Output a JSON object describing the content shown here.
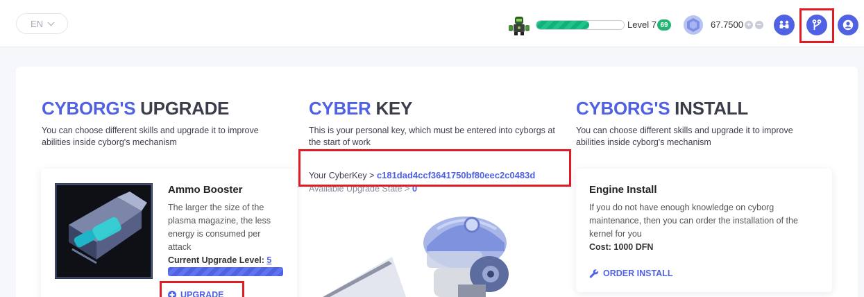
{
  "header": {
    "language": "EN",
    "level_label": "Level 7",
    "level_badge": "69",
    "xp_progress": 0.6,
    "balance": "67.7500"
  },
  "upgrade_section": {
    "title_accent": "CYBORG'S",
    "title_rest": " UPGRADE",
    "description": "You can choose different skills and upgrade it to improve abilities inside cyborg's mechanism",
    "card": {
      "title": "Ammo Booster",
      "text": "The larger the size of the plasma magazine, the less energy is consumed per attack",
      "level_label": "Current Upgrade Level: ",
      "level_value": "5",
      "level_progress": 1.0,
      "action": "UPGRADE"
    }
  },
  "key_section": {
    "title_accent": "CYBER",
    "title_rest": " KEY",
    "description": "This is your personal key, which must be entered into cyborgs at the start of work",
    "key_label": "Your CyberKey",
    "key_value": "c181dad4ccf3641750bf80eec2c0483d",
    "state_label": "Available Upgrade State",
    "state_value": "0"
  },
  "install_section": {
    "title_accent": "CYBORG'S",
    "title_rest": " INSTALL",
    "description": "You can choose different skills and upgrade it to improve abilities inside cyborg's mechanism",
    "card": {
      "title": "Engine Install",
      "text": "If you do not have enough knowledge on cyborg maintenance, then you can order the installation of the kernel for you",
      "cost": "Cost: 1000 DFN",
      "action": "ORDER INSTALL"
    }
  },
  "colors": {
    "accent": "#5062e4",
    "success": "#22b573",
    "highlight": "#e01b24"
  }
}
